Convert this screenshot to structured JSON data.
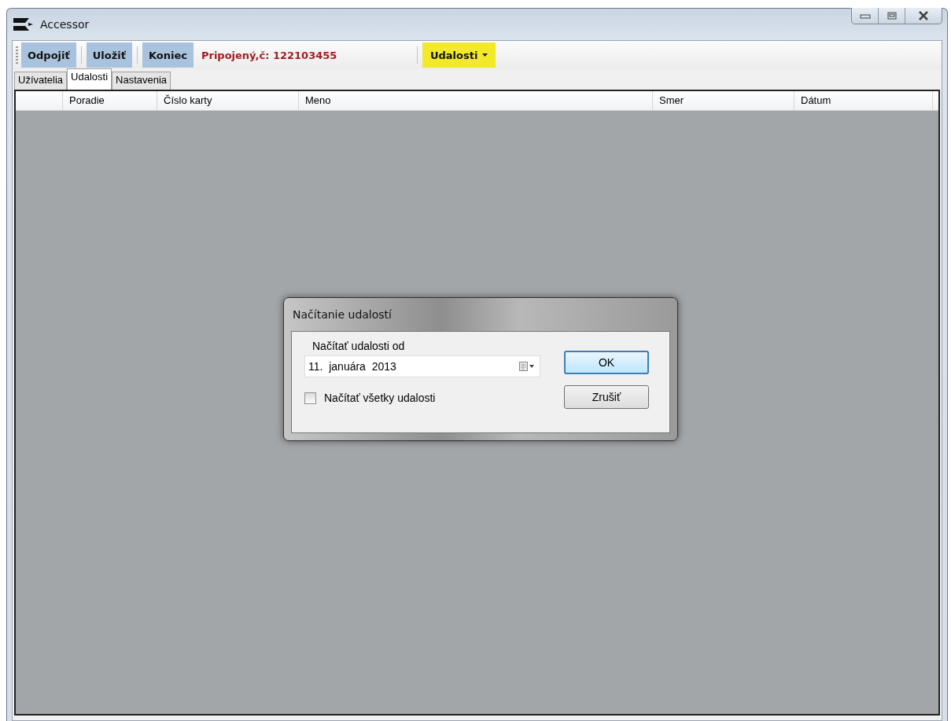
{
  "window": {
    "title": "Accessor"
  },
  "toolbar": {
    "buttons": [
      {
        "label": "Odpojiť"
      },
      {
        "label": "Uložiť"
      },
      {
        "label": "Koniec"
      }
    ],
    "status": "Pripojený,č: 122103455",
    "menu": {
      "label": "Udalosti"
    }
  },
  "tabs": [
    {
      "label": "Užívatelia",
      "selected": false
    },
    {
      "label": "Udalosti",
      "selected": true
    },
    {
      "label": "Nastavenia",
      "selected": false
    }
  ],
  "table": {
    "columns": [
      "Poradie",
      "Číslo karty",
      "Meno",
      "Smer",
      "Dátum"
    ]
  },
  "dialog": {
    "title": "Načítanie udalostí",
    "date_label": "Načítať udalosti od",
    "date_value": "11.  januára  2013",
    "checkbox": {
      "label": "Načítať všetky udalosti",
      "checked": false
    },
    "buttons": [
      {
        "label": "OK",
        "kind": "default"
      },
      {
        "label": "Zrušiť",
        "kind": "normal"
      }
    ]
  }
}
